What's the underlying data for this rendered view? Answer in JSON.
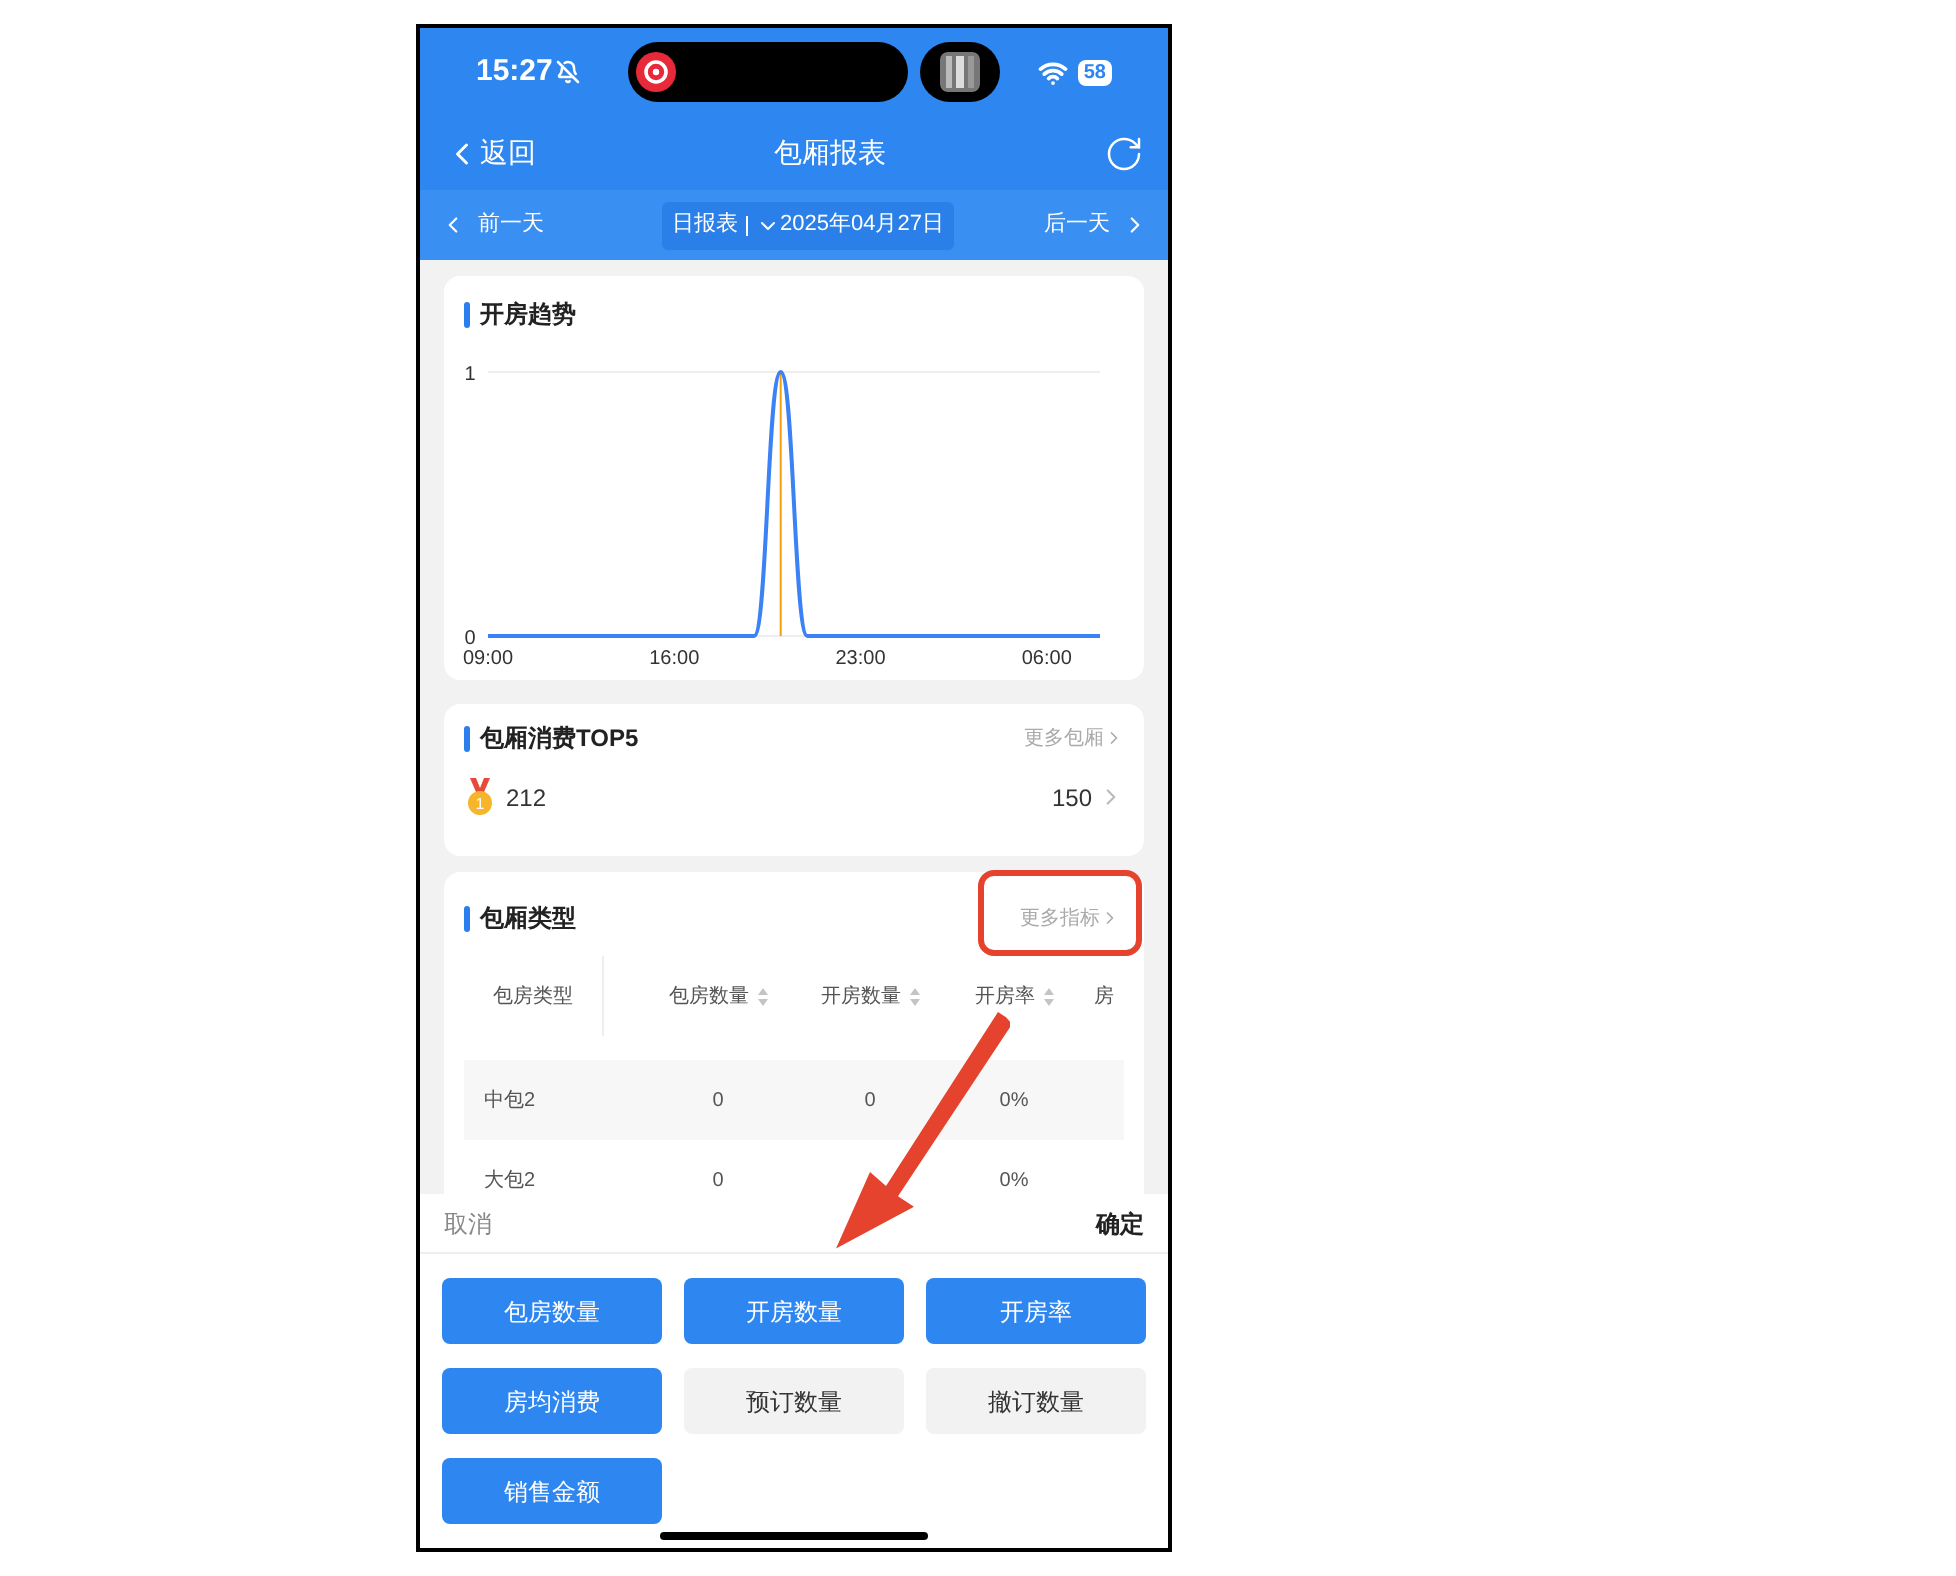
{
  "status_bar": {
    "time": "15:27",
    "battery": "58"
  },
  "nav": {
    "back": "返回",
    "title": "包厢报表"
  },
  "date_bar": {
    "prev": "前一天",
    "mode": "日报表",
    "date": "2025年04月27日",
    "next": "后一天"
  },
  "trend_card": {
    "title": "开房趋势",
    "chart_data": {
      "type": "line",
      "categories": [
        "09:00",
        null,
        null,
        null,
        null,
        null,
        null,
        "16:00",
        null,
        null,
        null,
        null,
        null,
        null,
        "23:00",
        null,
        null,
        null,
        null,
        null,
        null,
        "06:00",
        null,
        null
      ],
      "series": [
        {
          "color": "#3b82f6",
          "values": [
            0,
            0,
            0,
            0,
            0,
            0,
            0,
            0,
            0,
            0,
            0,
            1,
            0,
            0,
            0,
            0,
            0,
            0,
            0,
            0,
            0,
            0,
            0,
            0
          ]
        }
      ],
      "yticks": [
        0,
        1
      ],
      "ylim": [
        0,
        1
      ]
    }
  },
  "top5_card": {
    "title": "包厢消费TOP5",
    "more": "更多包厢",
    "items": [
      {
        "rank": "1",
        "name": "212",
        "amount": "150"
      }
    ]
  },
  "type_card": {
    "title": "包厢类型",
    "more": "更多指标",
    "columns": [
      "包房类型",
      "包房数量",
      "开房数量",
      "开房率",
      "房"
    ],
    "rows": [
      {
        "cells": [
          "中包2",
          "0",
          "0",
          "0%"
        ]
      },
      {
        "cells": [
          "大包2",
          "0",
          null,
          "0%"
        ]
      }
    ]
  },
  "sheet": {
    "cancel": "取消",
    "confirm": "确定",
    "options": [
      {
        "label": "包房数量",
        "selected": true
      },
      {
        "label": "开房数量",
        "selected": true
      },
      {
        "label": "开房率",
        "selected": true
      },
      {
        "label": "房均消费",
        "selected": true
      },
      {
        "label": "预订数量",
        "selected": false
      },
      {
        "label": "撤订数量",
        "selected": false
      },
      {
        "label": "销售金额",
        "selected": true
      }
    ]
  }
}
